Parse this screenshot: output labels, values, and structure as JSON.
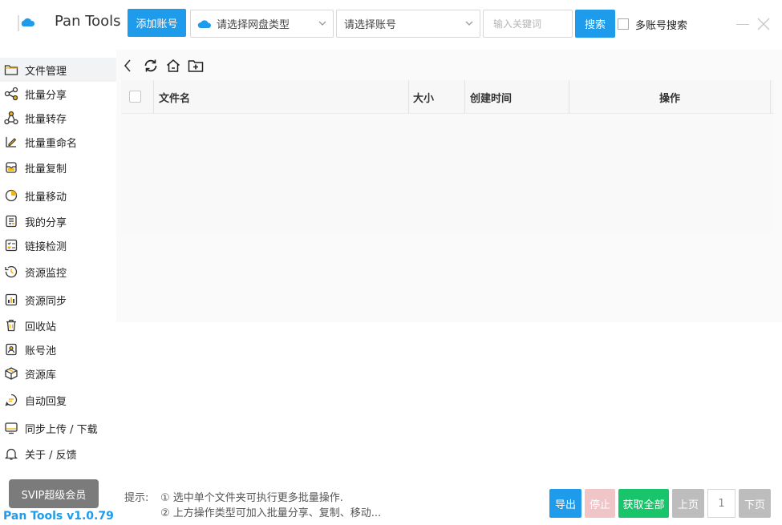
{
  "header": {
    "app_title": "Pan Tools",
    "add_account_label": "添加账号",
    "disk_type_placeholder": "请选择网盘类型",
    "account_placeholder": "请选择账号",
    "keyword_placeholder": "输入关键词",
    "search_label": "搜索",
    "multi_account_label": "多账号搜索"
  },
  "sidebar": {
    "items": [
      {
        "label": "文件管理",
        "icon": "folder-icon",
        "active": true
      },
      {
        "label": "批量分享",
        "icon": "share-icon"
      },
      {
        "label": "批量转存",
        "icon": "transfer-icon"
      },
      {
        "label": "批量重命名",
        "icon": "rename-icon"
      },
      {
        "label": "批量复制",
        "icon": "copy-icon"
      },
      {
        "label": "批量移动",
        "icon": "move-icon"
      },
      {
        "label": "我的分享",
        "icon": "my-share-icon"
      },
      {
        "label": "链接检测",
        "icon": "link-check-icon"
      },
      {
        "label": "资源监控",
        "icon": "monitor-icon"
      },
      {
        "label": "资源同步",
        "icon": "sync-chart-icon"
      },
      {
        "label": "回收站",
        "icon": "trash-icon"
      },
      {
        "label": "账号池",
        "icon": "account-pool-icon"
      },
      {
        "label": "资源库",
        "icon": "box-icon"
      },
      {
        "label": "自动回复",
        "icon": "auto-reply-icon"
      },
      {
        "label": "同步上传 / 下载",
        "icon": "upload-download-icon"
      },
      {
        "label": "关于 / 反馈",
        "icon": "bell-icon"
      }
    ],
    "svip_label": "SVIP超级会员",
    "version": "Pan Tools v1.0.79"
  },
  "table": {
    "columns": [
      "文件名",
      "大小",
      "创建时间",
      "操作"
    ]
  },
  "footer": {
    "tips_title": "提示:",
    "tip1": "① 选中单个文件夹可执行更多批量操作.",
    "tip2": "② 上方操作类型可加入批量分享、复制、移动...",
    "export_label": "导出",
    "stop_label": "停止",
    "get_all_label": "获取全部",
    "prev_label": "上页",
    "page_number": "1",
    "next_label": "下页"
  },
  "colors": {
    "accent": "#1e9bea",
    "success": "#18c56a",
    "disabled_red": "#f0c5c8",
    "disabled_gray": "#bdbdbd",
    "icon_yellow": "#f3b418"
  }
}
